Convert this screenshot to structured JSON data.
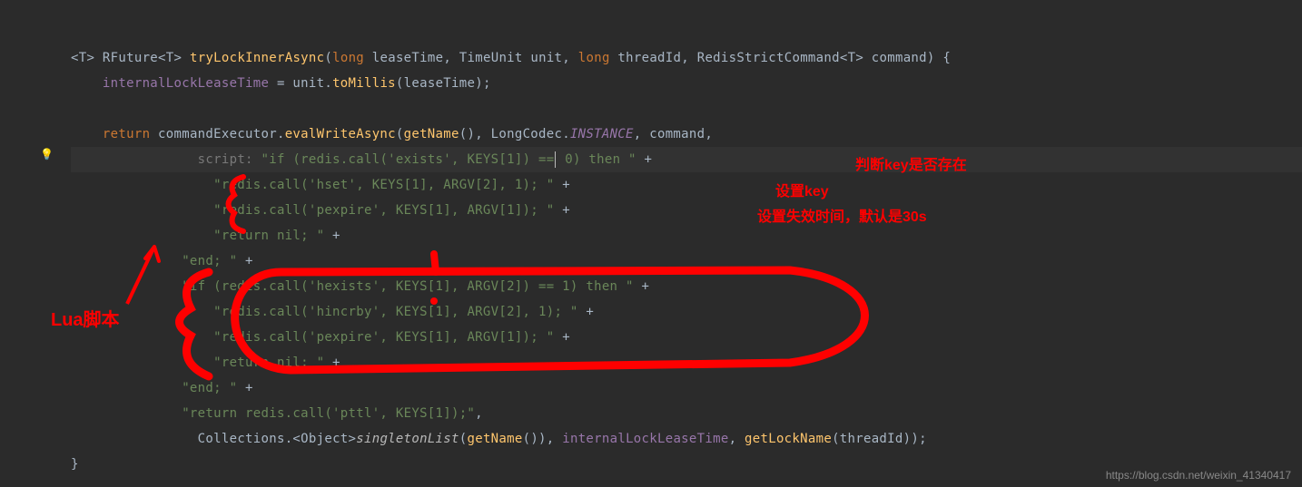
{
  "code": {
    "line1": {
      "t1": "<",
      "t2": "T",
      "t3": ">",
      "t4": " RFuture",
      "t5": "<",
      "t6": "T",
      "t7": ">",
      "t8": " ",
      "method": "tryLockInnerAsync",
      "t9": "(",
      "kw_long1": "long",
      "p1": " leaseTime",
      "c1": ", ",
      "type_tu": "TimeUnit",
      "p2": " unit",
      "c2": ", ",
      "kw_long2": "long",
      "p3": " threadId",
      "c3": ", ",
      "type_rsc": "RedisStrictCommand",
      "t10": "<",
      "t11": "T",
      "t12": ">",
      "p4": " command",
      "t13": ") {"
    },
    "line2": {
      "field": "internalLockLeaseTime",
      "t1": " = unit.",
      "m": "toMillis",
      "t2": "(leaseTime);"
    },
    "line3": {
      "kw": "return",
      "t1": " commandExecutor.",
      "m": "evalWriteAsync",
      "t2": "(",
      "m2": "getName",
      "t3": "(), LongCodec.",
      "inst": "INSTANCE",
      "t4": ", command,"
    },
    "line4": {
      "hint": "script: ",
      "s": "\"if (redis.call('exists', KEYS[1]) == 0) then \"",
      "plus": " +"
    },
    "line5": {
      "s": "\"redis.call('hset', KEYS[1], ARGV[2], 1); \"",
      "plus": " +"
    },
    "line6": {
      "s": "\"redis.call('pexpire', KEYS[1], ARGV[1]); \"",
      "plus": " +"
    },
    "line7": {
      "s": "\"return nil; \"",
      "plus": " +"
    },
    "line8": {
      "s": "\"end; \"",
      "plus": " +"
    },
    "line9": {
      "s": "\"if (redis.call('hexists', KEYS[1], ARGV[2]) == 1) then \"",
      "plus": " +"
    },
    "line10": {
      "s": "\"redis.call('hincrby', KEYS[1], ARGV[2], 1); \"",
      "plus": " +"
    },
    "line11": {
      "s": "\"redis.call('pexpire', KEYS[1], ARGV[1]); \"",
      "plus": " +"
    },
    "line12": {
      "s": "\"return nil; \"",
      "plus": " +"
    },
    "line13": {
      "s": "\"end; \"",
      "plus": " +"
    },
    "line14": {
      "s": "\"return redis.call('pttl', KEYS[1]);\"",
      "comma": ","
    },
    "line15": {
      "t1": "Collections.",
      "t2": "<Object>",
      "m": "singletonList",
      "t3": "(",
      "m2": "getName",
      "t4": "()), ",
      "field": "internalLockLeaseTime",
      "t5": ", ",
      "m3": "getLockName",
      "t6": "(threadId));"
    },
    "line16": {
      "t": "}"
    }
  },
  "annotations": {
    "a1": "判断key是否存在",
    "a2": "设置key",
    "a3": "设置失效时间，默认是30s",
    "lua": "Lua脚本"
  },
  "watermark": "https://blog.csdn.net/weixin_41340417",
  "icons": {
    "bulb": "💡"
  }
}
